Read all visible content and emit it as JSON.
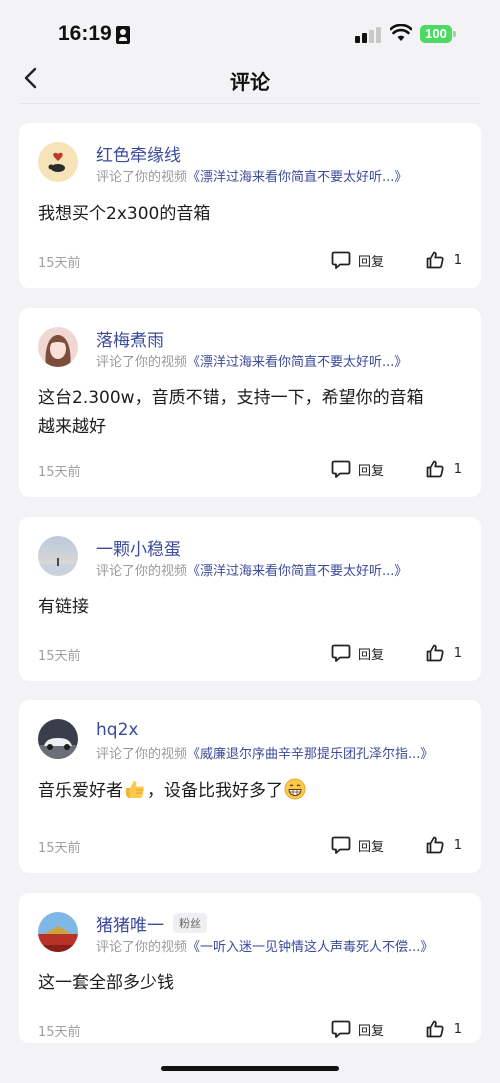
{
  "status_bar": {
    "time": "16:19",
    "battery": "100",
    "battery_color": "#4cd964"
  },
  "header": {
    "title": "评论",
    "back_icon": "chevron-left-icon"
  },
  "comments": [
    {
      "username": "红色牵缘线",
      "badge": "",
      "meta_prefix": "评论了你的视频",
      "video_title": "《漂洋过海来看你简直不要太好听...》",
      "text": "我想买个2x300的音箱",
      "time_ago": "15天前",
      "reply_label": "回复",
      "like_count": "1"
    },
    {
      "username": "落梅煮雨",
      "badge": "",
      "meta_prefix": "评论了你的视频",
      "video_title": "《漂洋过海来看你简直不要太好听...》",
      "text_line1": "这台2.300w，音质不错，支持一下，希望你的音箱",
      "text_line2": "越来越好",
      "time_ago": "15天前",
      "reply_label": "回复",
      "like_count": "1"
    },
    {
      "username": "一颗小稳蛋",
      "badge": "",
      "meta_prefix": "评论了你的视频",
      "video_title": "《漂洋过海来看你简直不要太好听...》",
      "text": "有链接",
      "time_ago": "15天前",
      "reply_label": "回复",
      "like_count": "1"
    },
    {
      "username": "hq2x",
      "badge": "",
      "meta_prefix": "评论了你的视频",
      "video_title": "《威廉退尔序曲辛辛那提乐团孔泽尔指...》",
      "text_part1": "音乐爱好者",
      "text_part2": "，设备比我好多了",
      "emoji1": "thumbs-up-emoji",
      "emoji2": "grinning-face-emoji",
      "time_ago": "15天前",
      "reply_label": "回复",
      "like_count": "1"
    },
    {
      "username": "猪猪唯一",
      "badge": "粉丝",
      "meta_prefix": "评论了你的视频",
      "video_title": "《一听入迷一见钟情这人声毒死人不偿...》",
      "text": "这一套全部多少钱",
      "time_ago": "15天前",
      "reply_label": "回复",
      "like_count": "1"
    }
  ],
  "colors": {
    "link": "#3b4a9c",
    "background": "#f3f3f6",
    "card": "#ffffff",
    "muted": "#a0a0a0"
  }
}
